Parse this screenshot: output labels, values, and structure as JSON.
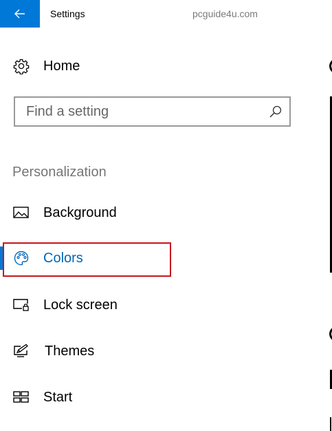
{
  "window": {
    "title": "Settings",
    "watermark": "pcguide4u.com",
    "accent_color": "#0078d7"
  },
  "home": {
    "label": "Home",
    "icon": "gear-icon"
  },
  "search": {
    "placeholder": "Find a setting",
    "value": "",
    "icon": "search-icon"
  },
  "section": {
    "heading": "Personalization"
  },
  "nav_items": [
    {
      "label": "Background",
      "icon": "image-icon",
      "selected": false
    },
    {
      "label": "Colors",
      "icon": "palette-icon",
      "selected": true
    },
    {
      "label": "Lock screen",
      "icon": "lock-screen-icon",
      "selected": false
    },
    {
      "label": "Themes",
      "icon": "themes-icon",
      "selected": false
    },
    {
      "label": "Start",
      "icon": "start-icon",
      "selected": false
    }
  ],
  "annotation": {
    "highlight_color": "#c4161c"
  }
}
